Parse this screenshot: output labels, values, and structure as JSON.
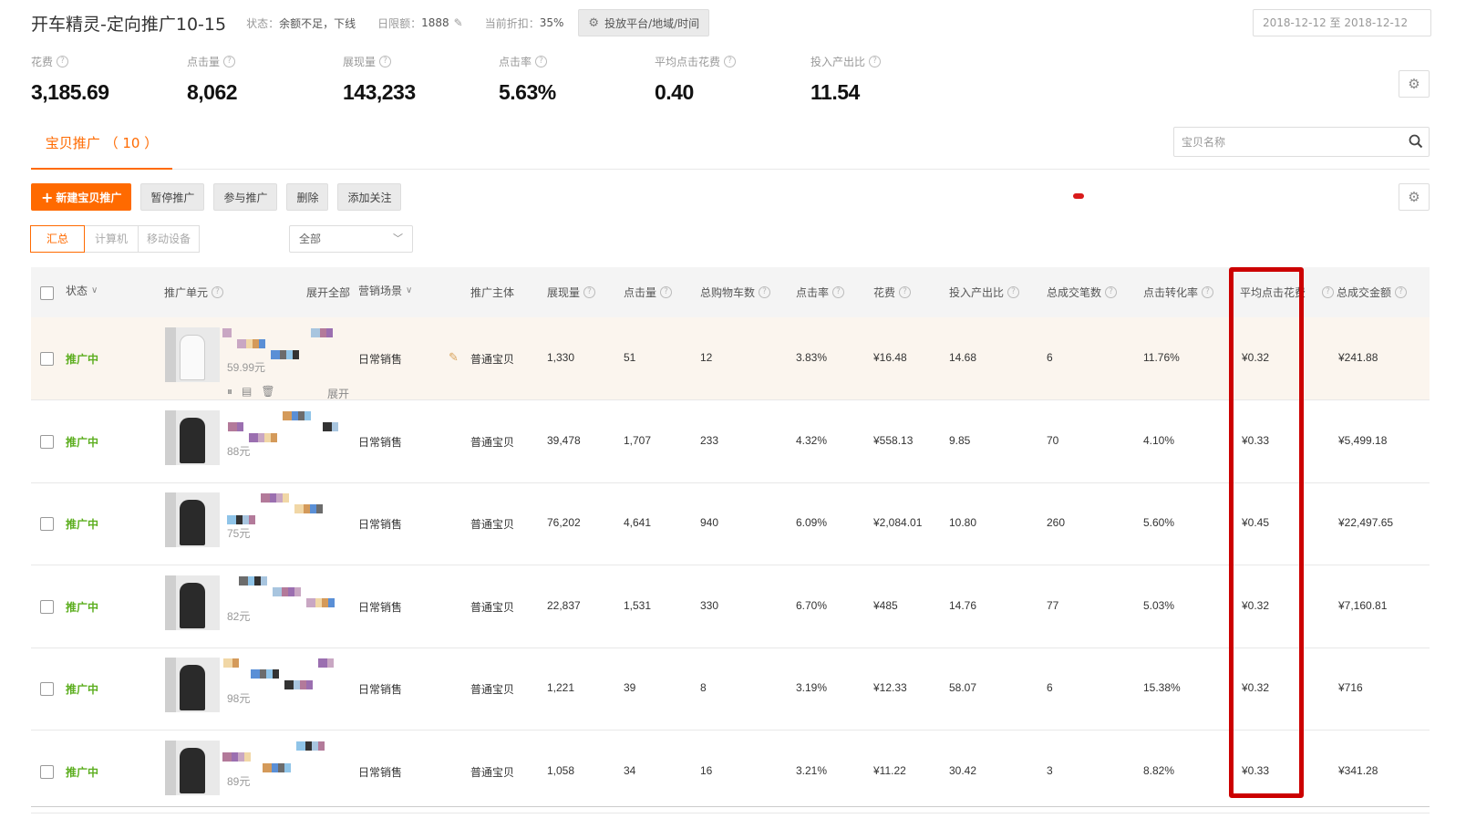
{
  "header": {
    "title": "开车精灵-定向推广10-15",
    "status_label": "状态：",
    "status_value": "余额不足，下线",
    "budget_label": "日限额：",
    "budget_value": "1888",
    "discount_label": "当前折扣：",
    "discount_value": "35%",
    "platform_button": "投放平台/地域/时间",
    "date_range": "2018-12-12 至 2018-12-12"
  },
  "metrics": [
    {
      "label": "花费",
      "value": "3,185.69"
    },
    {
      "label": "点击量",
      "value": "8,062"
    },
    {
      "label": "展现量",
      "value": "143,233"
    },
    {
      "label": "点击率",
      "value": "5.63%"
    },
    {
      "label": "平均点击花费",
      "value": "0.40"
    },
    {
      "label": "投入产出比",
      "value": "11.54"
    }
  ],
  "tabs": {
    "active": "宝贝推广 （ 10 ）"
  },
  "search": {
    "placeholder": "宝贝名称"
  },
  "toolbar": {
    "new": "新建宝贝推广",
    "pause": "暂停推广",
    "join": "参与推广",
    "delete": "删除",
    "follow": "添加关注"
  },
  "segments": [
    "汇总",
    "计算机",
    "移动设备"
  ],
  "filter_select": "全部",
  "columns": {
    "status": "状态",
    "unit": "推广单元",
    "expand_all": "展开全部",
    "scene": "营销场景",
    "subject": "推广主体",
    "impressions": "展现量",
    "clicks": "点击量",
    "carts": "总购物车数",
    "ctr": "点击率",
    "cost": "花费",
    "roi": "投入产出比",
    "orders": "总成交笔数",
    "cvr": "点击转化率",
    "cpc": "平均点击花费",
    "gmv": "总成交金额"
  },
  "row_actions": {
    "expand": "展开"
  },
  "rows": [
    {
      "status": "推广中",
      "price": "59.99元",
      "scene": "日常销售",
      "subject": "普通宝贝",
      "impressions": "1,330",
      "clicks": "51",
      "carts": "12",
      "ctr": "3.83%",
      "cost": "¥16.48",
      "roi": "14.68",
      "orders": "6",
      "cvr": "11.76%",
      "cpc": "¥0.32",
      "gmv": "¥241.88"
    },
    {
      "status": "推广中",
      "price": "88元",
      "scene": "日常销售",
      "subject": "普通宝贝",
      "impressions": "39,478",
      "clicks": "1,707",
      "carts": "233",
      "ctr": "4.32%",
      "cost": "¥558.13",
      "roi": "9.85",
      "orders": "70",
      "cvr": "4.10%",
      "cpc": "¥0.33",
      "gmv": "¥5,499.18"
    },
    {
      "status": "推广中",
      "price": "75元",
      "scene": "日常销售",
      "subject": "普通宝贝",
      "impressions": "76,202",
      "clicks": "4,641",
      "carts": "940",
      "ctr": "6.09%",
      "cost": "¥2,084.01",
      "roi": "10.80",
      "orders": "260",
      "cvr": "5.60%",
      "cpc": "¥0.45",
      "gmv": "¥22,497.65"
    },
    {
      "status": "推广中",
      "price": "82元",
      "scene": "日常销售",
      "subject": "普通宝贝",
      "impressions": "22,837",
      "clicks": "1,531",
      "carts": "330",
      "ctr": "6.70%",
      "cost": "¥485",
      "roi": "14.76",
      "orders": "77",
      "cvr": "5.03%",
      "cpc": "¥0.32",
      "gmv": "¥7,160.81"
    },
    {
      "status": "推广中",
      "price": "98元",
      "scene": "日常销售",
      "subject": "普通宝贝",
      "impressions": "1,221",
      "clicks": "39",
      "carts": "8",
      "ctr": "3.19%",
      "cost": "¥12.33",
      "roi": "58.07",
      "orders": "6",
      "cvr": "15.38%",
      "cpc": "¥0.32",
      "gmv": "¥716"
    },
    {
      "status": "推广中",
      "price": "89元",
      "scene": "日常销售",
      "subject": "普通宝贝",
      "impressions": "1,058",
      "clicks": "34",
      "carts": "16",
      "ctr": "3.21%",
      "cost": "¥11.22",
      "roi": "30.42",
      "orders": "3",
      "cvr": "8.82%",
      "cpc": "¥0.33",
      "gmv": "¥341.28"
    }
  ],
  "colors": {
    "accent": "#ff6a00",
    "status_green": "#5cae1f",
    "highlight_frame": "#cc0000",
    "highlight_row": "#fbf5ee"
  }
}
